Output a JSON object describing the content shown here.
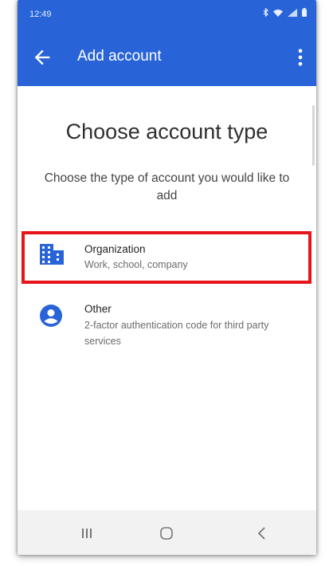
{
  "status_bar": {
    "time": "12:49"
  },
  "app_bar": {
    "title": "Add account"
  },
  "content": {
    "heading": "Choose account type",
    "subheading": "Choose the type of account you would like to add",
    "options": [
      {
        "title": "Organization",
        "subtitle": "Work, school, company",
        "icon": "building-icon",
        "highlighted": true
      },
      {
        "title": "Other",
        "subtitle": "2-factor authentication code for third party services",
        "icon": "person-icon",
        "highlighted": false
      }
    ]
  },
  "colors": {
    "accent": "#2864d8",
    "highlight": "#e8141b",
    "nav_bar": "#f2f2f2"
  }
}
